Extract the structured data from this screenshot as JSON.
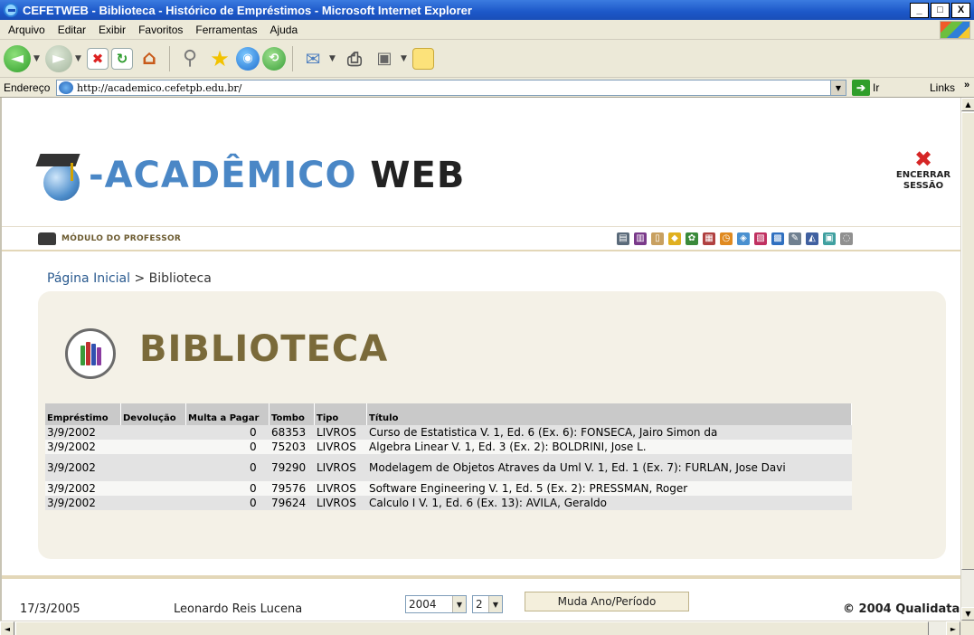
{
  "window": {
    "title": "CEFETWEB - Biblioteca - Histórico de Empréstimos - Microsoft Internet Explorer",
    "min": "_",
    "max": "□",
    "close": "X"
  },
  "menu": [
    "Arquivo",
    "Editar",
    "Exibir",
    "Favoritos",
    "Ferramentas",
    "Ajuda"
  ],
  "address": {
    "label": "Endereço",
    "url": "http://academico.cefetpb.edu.br/",
    "go": "Ir",
    "links": "Links"
  },
  "header": {
    "logo_part1": "-ACADÊMICO",
    "logo_part2": "WEB",
    "logout_line1": "ENCERRAR",
    "logout_line2": "SESSÃO",
    "module": "MÓDULO DO PROFESSOR"
  },
  "breadcrumb": {
    "home": "Página Inicial",
    "sep": " > ",
    "current": "Biblioteca"
  },
  "section": {
    "title": "BIBLIOTECA"
  },
  "table": {
    "headers": [
      "Empréstimo",
      "Devolução",
      "Multa a Pagar",
      "Tombo",
      "Tipo",
      "Título"
    ],
    "rows": [
      [
        "3/9/2002",
        "",
        "0",
        "68353",
        "LIVROS",
        "Curso de Estatistica V. 1, Ed. 6 (Ex. 6): FONSECA, Jairo Simon da"
      ],
      [
        "3/9/2002",
        "",
        "0",
        "75203",
        "LIVROS",
        "Algebra Linear V. 1, Ed. 3 (Ex. 2): BOLDRINI, Jose L."
      ],
      [
        "3/9/2002",
        "",
        "0",
        "79290",
        "LIVROS",
        "Modelagem de Objetos Atraves da Uml V. 1, Ed. 1 (Ex. 7): FURLAN, Jose Davi"
      ],
      [
        "3/9/2002",
        "",
        "0",
        "79576",
        "LIVROS",
        "Software Engineering V. 1, Ed. 5 (Ex. 2): PRESSMAN, Roger"
      ],
      [
        "3/9/2002",
        "",
        "0",
        "79624",
        "LIVROS",
        "Calculo I V. 1, Ed. 6 (Ex. 13): AVILA, Geraldo"
      ]
    ]
  },
  "footer": {
    "date": "17/3/2005",
    "user": "Leonardo Reis Lucena",
    "year": "2004",
    "period": "2",
    "button": "Muda Ano/Período",
    "copyright": "© 2004 Qualidata"
  },
  "colors": {
    "titlebar": "#1c57c8",
    "logo_blue": "#4a87c6",
    "section_title": "#7a6a3a",
    "panel_bg": "#f4f1e7",
    "logout_x": "#d62626"
  },
  "icons": {
    "toolbar": [
      "back-icon",
      "forward-icon",
      "stop-icon",
      "refresh-icon",
      "home-icon",
      "search-icon",
      "favorites-icon",
      "media-icon",
      "history-icon",
      "mail-icon",
      "print-icon",
      "edit-icon",
      "notes-icon"
    ],
    "module_row": [
      "window-icon",
      "books-icon",
      "clipboard-icon",
      "lock-icon",
      "gear-icon",
      "calendar-icon",
      "clock-icon",
      "paint-icon",
      "notebook-icon",
      "grid-icon",
      "pencil-icon",
      "chart-icon",
      "image-icon",
      "refresh-doc-icon"
    ]
  }
}
